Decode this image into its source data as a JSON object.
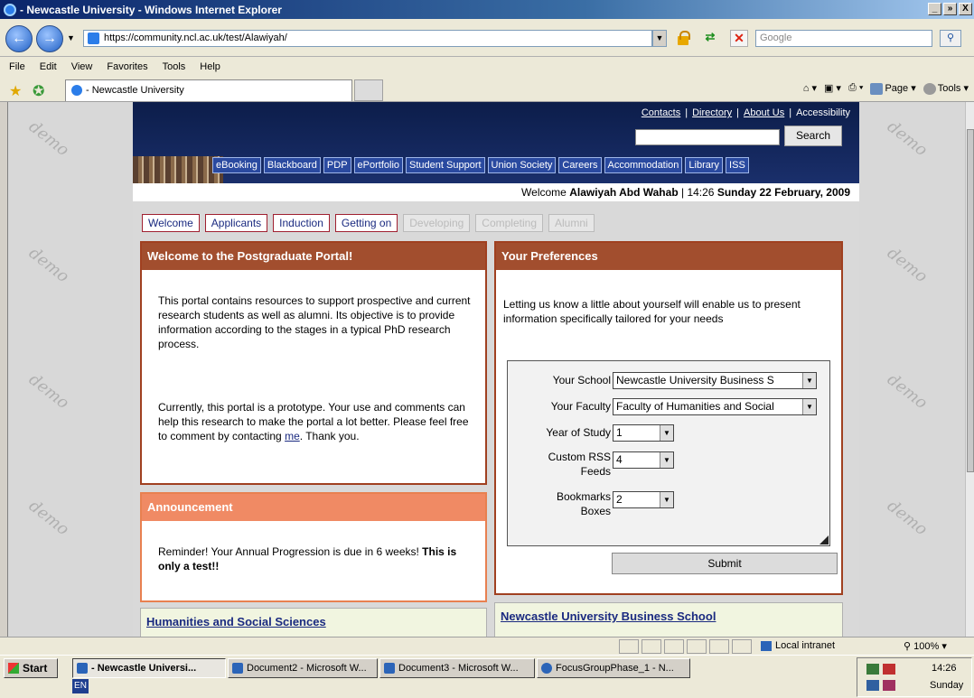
{
  "window": {
    "title": "- Newcastle University - Windows Internet Explorer",
    "controls": [
      "_",
      "»",
      "X"
    ]
  },
  "address": {
    "url": "https://community.ncl.ac.uk/test/Alawiyah/",
    "search_placeholder": "Google"
  },
  "menu": [
    "File",
    "Edit",
    "View",
    "Favorites",
    "Tools",
    "Help"
  ],
  "tab": {
    "title": "- Newcastle University"
  },
  "commands": {
    "page": "Page",
    "tools": "Tools"
  },
  "site": {
    "toplinks": [
      "Contacts",
      "Directory",
      "About Us",
      "Accessibility"
    ],
    "search_button": "Search",
    "quicklinks": [
      "eBooking",
      "Blackboard",
      "PDP",
      "ePortfolio",
      "Student Support",
      "Union Society",
      "Careers",
      "Accommodation",
      "Library",
      "ISS"
    ],
    "welcome_prefix": "Welcome ",
    "user": "Alawiyah Abd Wahab",
    "time": " | 14:26 ",
    "date": "Sunday 22 February, 2009",
    "tabs": [
      {
        "label": "Welcome",
        "enabled": true
      },
      {
        "label": "Applicants",
        "enabled": true
      },
      {
        "label": "Induction",
        "enabled": true
      },
      {
        "label": "Getting on",
        "enabled": true
      },
      {
        "label": "Developing",
        "enabled": false
      },
      {
        "label": "Completing",
        "enabled": false
      },
      {
        "label": "Alumni",
        "enabled": false
      }
    ]
  },
  "welcome_panel": {
    "title": "Welcome to the Postgraduate Portal!",
    "para1": "This portal contains resources to support prospective and current research students as well as alumni. Its objective is to provide information according to the stages in a typical PhD research process.",
    "para2_before": "Currently, this portal is a prototype. Your use and comments can help this research to make the portal a lot better. Please feel free to comment by contacting ",
    "para2_link": "me",
    "para2_after": ". Thank you."
  },
  "announcement": {
    "title": "Announcement",
    "text": "Reminder! Your Annual Progression is due in 6 weeks! ",
    "bold": "This is only a test!!"
  },
  "humanities": {
    "title": "Humanities and Social Sciences"
  },
  "business": {
    "title": "Newcastle University Business School"
  },
  "preferences": {
    "title": "Your Preferences",
    "intro": "Letting us know a little about yourself will enable us to present information specifically tailored for your needs",
    "school_label": "Your School",
    "school_value": "Newcastle University Business S",
    "faculty_label": "Your Faculty",
    "faculty_value": "Faculty of Humanities and Social",
    "year_label": "Year of Study",
    "year_value": "1",
    "rss_label_1": "Custom RSS",
    "rss_label_2": "Feeds",
    "rss_value": "4",
    "bookmarks_label_1": "Bookmarks",
    "bookmarks_label_2": "Boxes",
    "bookmarks_value": "2",
    "submit": "Submit"
  },
  "watermark": "demo",
  "status": {
    "zone": "Local intranet",
    "zoom": "100%"
  },
  "taskbar": {
    "start": "Start",
    "tasks": [
      "- Newcastle Universi...",
      "Document2 - Microsoft W...",
      "Document3 - Microsoft W...",
      "FocusGroupPhase_1 - N..."
    ],
    "lang": "EN",
    "time": "14:26",
    "day": "Sunday"
  }
}
